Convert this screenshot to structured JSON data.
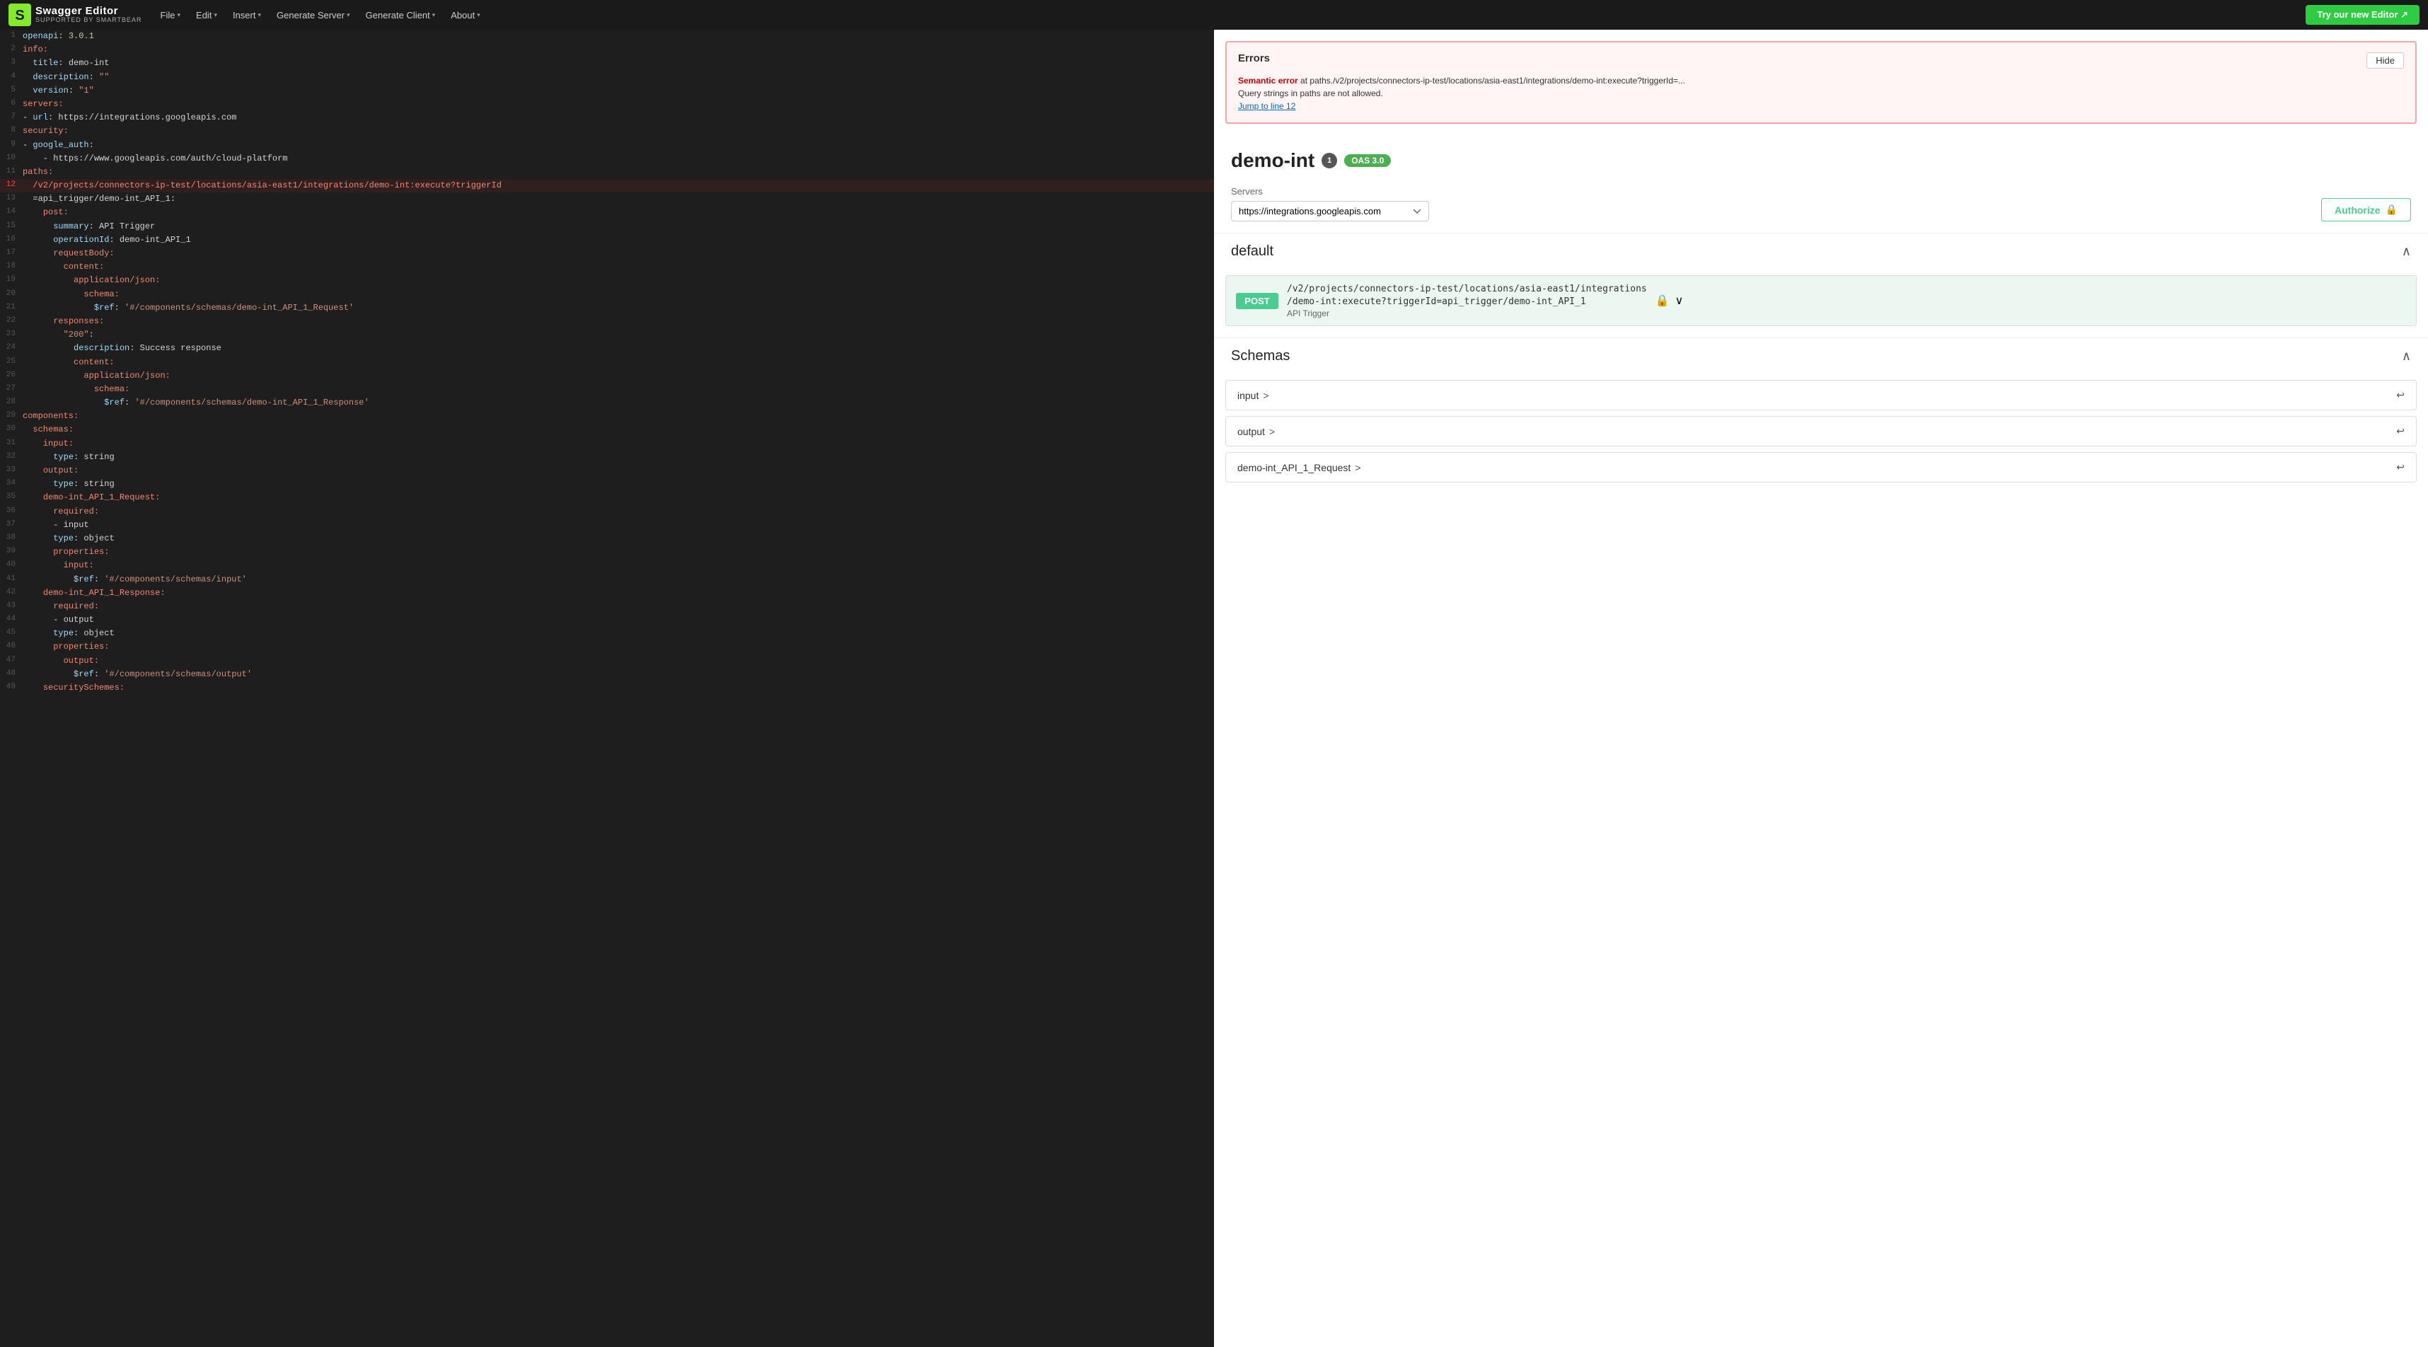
{
  "navbar": {
    "logo_main": "Swagger Editor",
    "logo_sub": "SUPPORTED BY SMARTBEAR",
    "menu": [
      {
        "label": "File",
        "has_arrow": true
      },
      {
        "label": "Edit",
        "has_arrow": true
      },
      {
        "label": "Insert",
        "has_arrow": true
      },
      {
        "label": "Generate Server",
        "has_arrow": true
      },
      {
        "label": "Generate Client",
        "has_arrow": true
      },
      {
        "label": "About",
        "has_arrow": true
      }
    ],
    "try_new_editor": "Try our new Editor ↗"
  },
  "editor": {
    "lines": [
      {
        "num": 1,
        "text": "openapi: 3.0.1",
        "classes": ""
      },
      {
        "num": 2,
        "text": "info:",
        "classes": ""
      },
      {
        "num": 3,
        "text": "  title: demo-int",
        "classes": ""
      },
      {
        "num": 4,
        "text": "  description: \"\"",
        "classes": ""
      },
      {
        "num": 5,
        "text": "  version: \"1\"",
        "classes": ""
      },
      {
        "num": 6,
        "text": "servers:",
        "classes": ""
      },
      {
        "num": 7,
        "text": "- url: https://integrations.googleapis.com",
        "classes": ""
      },
      {
        "num": 8,
        "text": "security:",
        "classes": ""
      },
      {
        "num": 9,
        "text": "- google_auth:",
        "classes": ""
      },
      {
        "num": 10,
        "text": "  - https://www.googleapis.com/auth/cloud-platform",
        "classes": ""
      },
      {
        "num": 11,
        "text": "paths:",
        "classes": ""
      },
      {
        "num": 12,
        "text": "  /v2/projects/connectors-ip-test/locations/asia-east1/integrations/demo-int:execute?triggerId",
        "classes": "error-line",
        "error": true
      },
      {
        "num": 13,
        "text": "  =api_trigger/demo-int_API_1:",
        "classes": ""
      },
      {
        "num": 14,
        "text": "    post:",
        "classes": ""
      },
      {
        "num": 15,
        "text": "      summary: API Trigger",
        "classes": ""
      },
      {
        "num": 16,
        "text": "      operationId: demo-int_API_1",
        "classes": ""
      },
      {
        "num": 17,
        "text": "      requestBody:",
        "classes": ""
      },
      {
        "num": 18,
        "text": "        content:",
        "classes": ""
      },
      {
        "num": 19,
        "text": "          application/json:",
        "classes": ""
      },
      {
        "num": 20,
        "text": "            schema:",
        "classes": ""
      },
      {
        "num": 21,
        "text": "              $ref: '#/components/schemas/demo-int_API_1_Request'",
        "classes": ""
      },
      {
        "num": 22,
        "text": "      responses:",
        "classes": ""
      },
      {
        "num": 23,
        "text": "        \"200\":",
        "classes": ""
      },
      {
        "num": 24,
        "text": "          description: Success response",
        "classes": ""
      },
      {
        "num": 25,
        "text": "          content:",
        "classes": ""
      },
      {
        "num": 26,
        "text": "            application/json:",
        "classes": ""
      },
      {
        "num": 27,
        "text": "              schema:",
        "classes": ""
      },
      {
        "num": 28,
        "text": "                $ref: '#/components/schemas/demo-int_API_1_Response'",
        "classes": ""
      },
      {
        "num": 29,
        "text": "components:",
        "classes": ""
      },
      {
        "num": 30,
        "text": "  schemas:",
        "classes": ""
      },
      {
        "num": 31,
        "text": "    input:",
        "classes": ""
      },
      {
        "num": 32,
        "text": "      type: string",
        "classes": ""
      },
      {
        "num": 33,
        "text": "    output:",
        "classes": ""
      },
      {
        "num": 34,
        "text": "      type: string",
        "classes": ""
      },
      {
        "num": 35,
        "text": "    demo-int_API_1_Request:",
        "classes": ""
      },
      {
        "num": 36,
        "text": "      required:",
        "classes": ""
      },
      {
        "num": 37,
        "text": "      - input",
        "classes": ""
      },
      {
        "num": 38,
        "text": "      type: object",
        "classes": ""
      },
      {
        "num": 39,
        "text": "      properties:",
        "classes": ""
      },
      {
        "num": 40,
        "text": "        input:",
        "classes": ""
      },
      {
        "num": 41,
        "text": "          $ref: '#/components/schemas/input'",
        "classes": ""
      },
      {
        "num": 42,
        "text": "    demo-int_API_1_Response:",
        "classes": ""
      },
      {
        "num": 43,
        "text": "      required:",
        "classes": ""
      },
      {
        "num": 44,
        "text": "      - output",
        "classes": ""
      },
      {
        "num": 45,
        "text": "      type: object",
        "classes": ""
      },
      {
        "num": 46,
        "text": "      properties:",
        "classes": ""
      },
      {
        "num": 47,
        "text": "        output:",
        "classes": ""
      },
      {
        "num": 48,
        "text": "          $ref: '#/components/schemas/output'",
        "classes": ""
      },
      {
        "num": 49,
        "text": "    securitySchemes:",
        "classes": ""
      }
    ]
  },
  "errors": {
    "title": "Errors",
    "hide_label": "Hide",
    "message_prefix": "Semantic error",
    "message_path": "at paths./v2/projects/connectors-ip-test/locations/asia-east1/integrations/demo-int:execute?triggerId=...",
    "message_body": "Query strings in paths are not allowed.",
    "jump_link": "Jump to line 12"
  },
  "api": {
    "title": "demo-int",
    "version_badge": "1",
    "oas_badge": "OAS 3.0"
  },
  "servers": {
    "label": "Servers",
    "options": [
      "https://integrations.googleapis.com"
    ],
    "selected": "https://integrations.googleapis.com"
  },
  "authorize": {
    "label": "Authorize"
  },
  "default_section": {
    "title": "default",
    "endpoint": {
      "method": "POST",
      "path_line1": "/v2/projects/connectors-ip-test/locations/asia-east1/integrations",
      "path_line2": "/demo-int:execute?triggerId=api_trigger/demo-int_API_1",
      "summary": "API Trigger"
    }
  },
  "schemas_section": {
    "title": "Schemas",
    "items": [
      {
        "name": "input"
      },
      {
        "name": "output"
      },
      {
        "name": "demo-int_API_1_Request"
      }
    ]
  }
}
